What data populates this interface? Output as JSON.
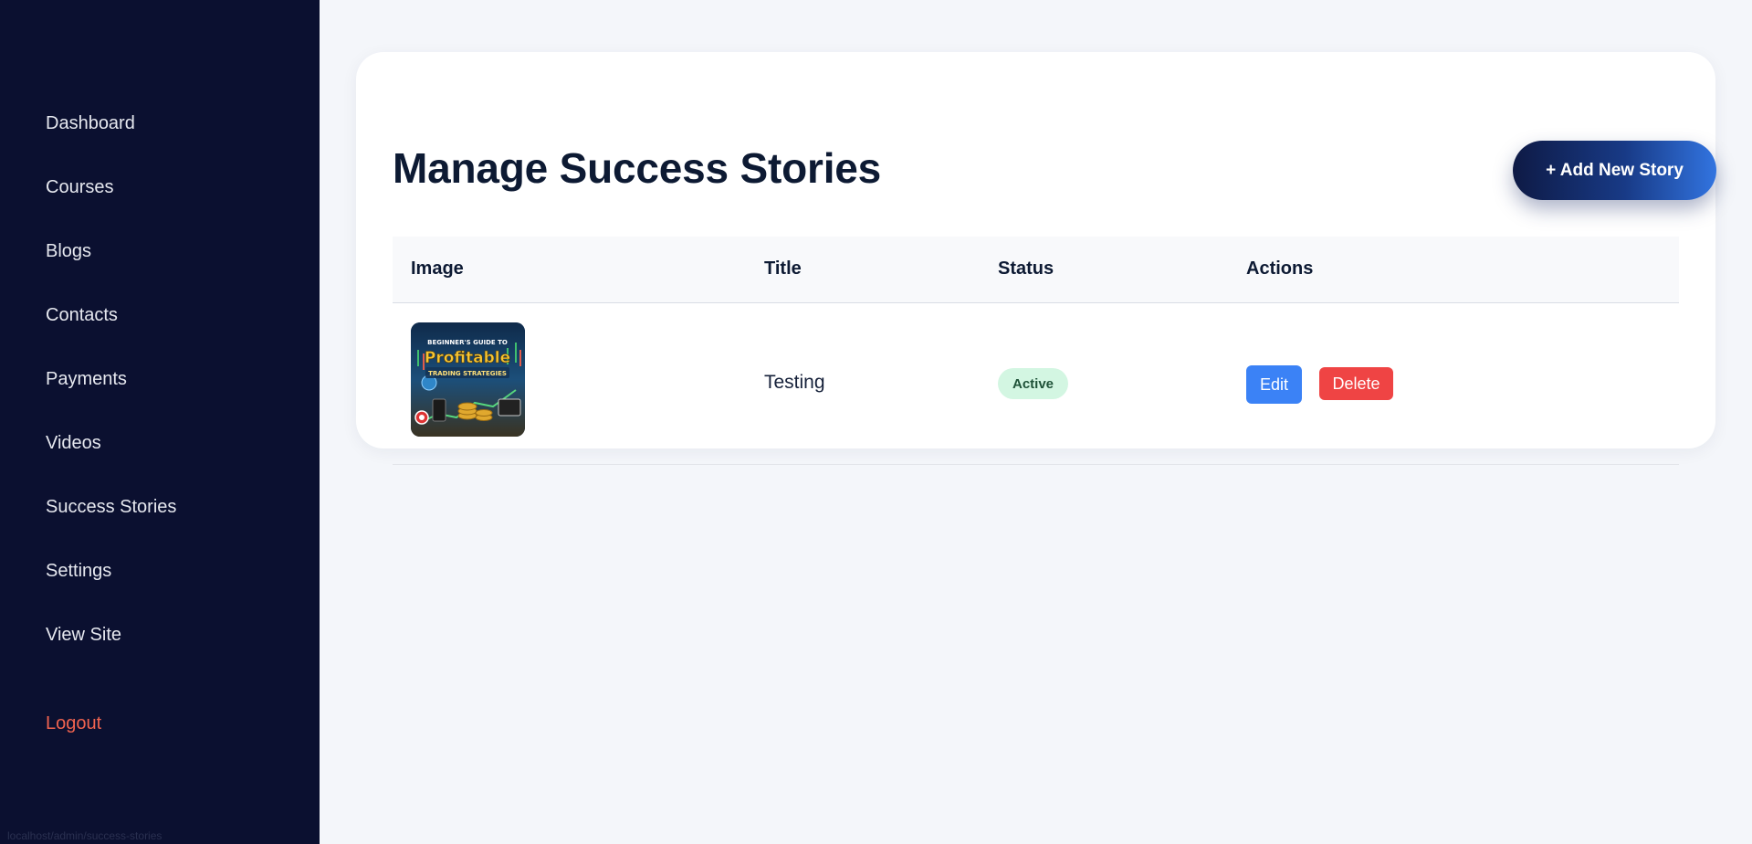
{
  "sidebar": {
    "items": [
      {
        "label": "Dashboard"
      },
      {
        "label": "Courses"
      },
      {
        "label": "Blogs"
      },
      {
        "label": "Contacts"
      },
      {
        "label": "Payments"
      },
      {
        "label": "Videos"
      },
      {
        "label": "Success Stories"
      },
      {
        "label": "Settings"
      },
      {
        "label": "View Site"
      }
    ],
    "logout_label": "Logout",
    "status_url": "localhost/admin/success-stories"
  },
  "main": {
    "title": "Manage Success Stories",
    "add_button_label": "+ Add New Story",
    "table": {
      "headers": [
        "Image",
        "Title",
        "Status",
        "Actions"
      ],
      "rows": [
        {
          "image_text_top": "BEGINNER'S GUIDE TO",
          "image_text_main": "Profitable",
          "image_text_sub": "TRADING STRATEGIES",
          "title": "Testing",
          "status": "Active",
          "edit_label": "Edit",
          "delete_label": "Delete"
        }
      ]
    }
  },
  "colors": {
    "sidebar_bg": "#0b1030",
    "logout": "#f0634f",
    "edit": "#3b82f6",
    "delete": "#ef4444",
    "badge_bg": "#d3f6e2"
  }
}
